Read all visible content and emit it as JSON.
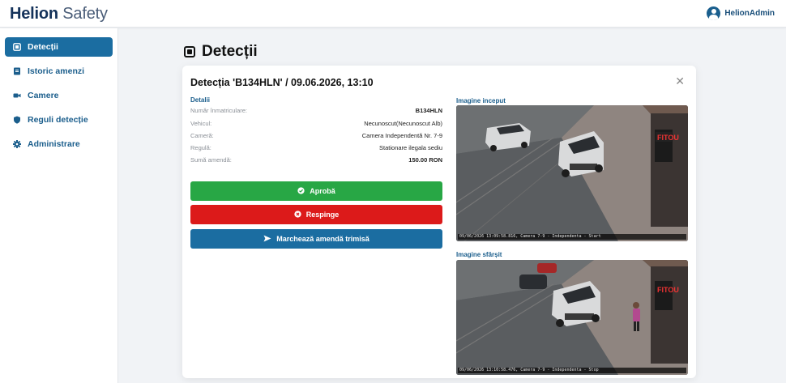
{
  "app": {
    "brand_bold": "Helion",
    "brand_light": "Safety",
    "user_name": "HelionAdmin"
  },
  "sidebar": {
    "items": [
      {
        "label": "Detecții",
        "icon": "detection-icon",
        "active": true
      },
      {
        "label": "Istoric amenzi",
        "icon": "history-icon",
        "active": false
      },
      {
        "label": "Camere",
        "icon": "camera-icon",
        "active": false
      },
      {
        "label": "Reguli detecție",
        "icon": "shield-icon",
        "active": false
      },
      {
        "label": "Administrare",
        "icon": "gear-icon",
        "active": false
      }
    ]
  },
  "page": {
    "title": "Detecții"
  },
  "detail": {
    "title": "Detecția 'B134HLN' / 09.06.2026, 13:10",
    "section_label": "Detalii",
    "rows": [
      {
        "key": "Număr înmatriculare:",
        "value": "B134HLN"
      },
      {
        "key": "Vehicul:",
        "value": "Necunoscut(Necunoscut Alb)"
      },
      {
        "key": "Cameră:",
        "value": "Camera Independentă Nr. 7-9"
      },
      {
        "key": "Regulă:",
        "value": "Stationare ilegala sediu"
      },
      {
        "key": "Sumă amendă:",
        "value": "150.00 RON"
      }
    ],
    "buttons": {
      "approve": "Aprobă",
      "reject": "Respinge",
      "mark_sent": "Marchează amendă trimisă"
    },
    "image_start_label": "Imagine inceput",
    "image_end_label": "Imagine sfârșit",
    "image_start_stamp": "09/06/2026 13:09:58.816, Camera 7-9 - Independenta - Start",
    "image_end_stamp": "09/06/2026 13:10:58.476, Camera 7-9 - Independenta - Stop",
    "storefront_sign": "FITOU"
  },
  "colors": {
    "primary": "#1b6da1",
    "approve": "#28a745",
    "reject": "#dc1a1a"
  }
}
